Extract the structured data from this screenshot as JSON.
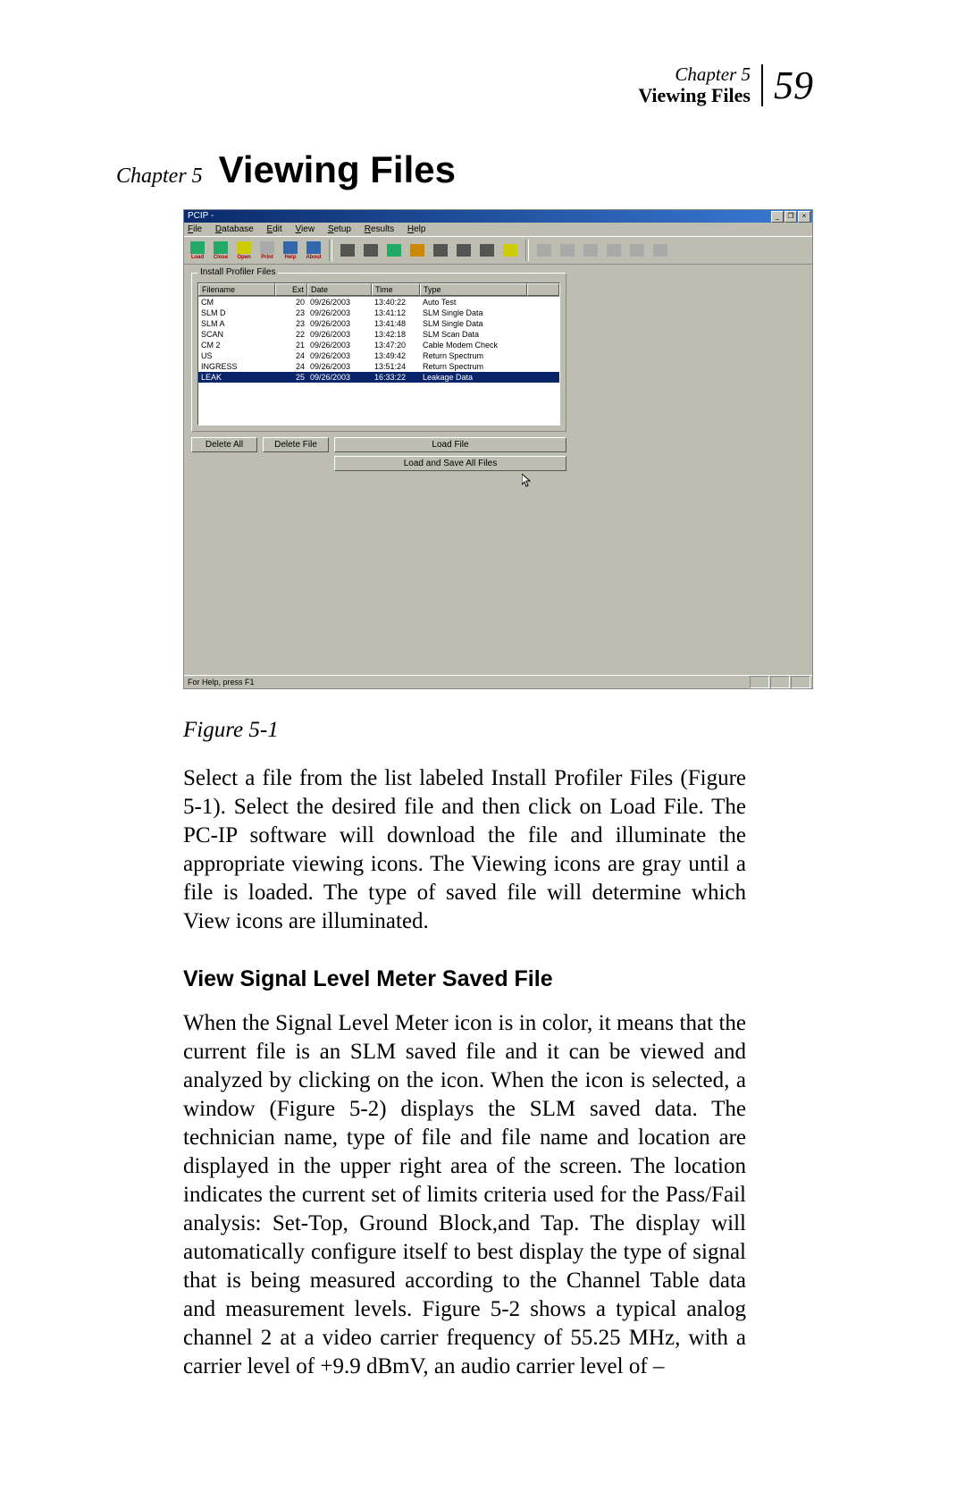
{
  "header": {
    "chapter_label": "Chapter 5",
    "title": "Viewing Files",
    "page_number": "59"
  },
  "chapter_heading": {
    "label": "Chapter 5",
    "title": "Viewing Files"
  },
  "screenshot": {
    "window_title": "PCIP -",
    "window_buttons": {
      "min": "_",
      "max": "❐",
      "close": "×"
    },
    "menu": [
      "File",
      "Database",
      "Edit",
      "View",
      "Setup",
      "Results",
      "Help"
    ],
    "toolbar_labels": [
      "Load",
      "Close",
      "Open",
      "Print",
      "Help",
      "About"
    ],
    "groupbox_title": "Install Profiler Files",
    "columns": [
      "Filename",
      "Ext",
      "Date",
      "Time",
      "Type"
    ],
    "rows": [
      {
        "filename": "CM",
        "ext": "20",
        "date": "09/26/2003",
        "time": "13:40:22",
        "type": "Auto Test"
      },
      {
        "filename": "SLM D",
        "ext": "23",
        "date": "09/26/2003",
        "time": "13:41:12",
        "type": "SLM Single Data"
      },
      {
        "filename": "SLM A",
        "ext": "23",
        "date": "09/26/2003",
        "time": "13:41:48",
        "type": "SLM Single Data"
      },
      {
        "filename": "SCAN",
        "ext": "22",
        "date": "09/26/2003",
        "time": "13:42:18",
        "type": "SLM Scan Data"
      },
      {
        "filename": "CM 2",
        "ext": "21",
        "date": "09/26/2003",
        "time": "13:47:20",
        "type": "Cable Modem Check"
      },
      {
        "filename": "US",
        "ext": "24",
        "date": "09/26/2003",
        "time": "13:49:42",
        "type": "Return Spectrum"
      },
      {
        "filename": "INGRESS",
        "ext": "24",
        "date": "09/26/2003",
        "time": "13:51:24",
        "type": "Return Spectrum"
      },
      {
        "filename": "LEAK",
        "ext": "25",
        "date": "09/26/2003",
        "time": "16:33:22",
        "type": "Leakage Data"
      }
    ],
    "buttons": {
      "delete_all": "Delete All",
      "delete_file": "Delete File",
      "load_file": "Load File",
      "load_save_all": "Load and Save All Files"
    },
    "statusbar": "For Help, press F1"
  },
  "figure_caption": "Figure 5-1",
  "paragraph1": "Select a file from the list labeled Install Profiler Files (Figure 5-1). Select the desired file and then click on Load File. The PC-IP software will download the file and illuminate the appropriate viewing icons. The Viewing icons are gray until a file is loaded. The type of saved file will determine which View icons are illuminated.",
  "section_heading": "View Signal Level Meter Saved File",
  "paragraph2": "When the Signal Level Meter icon is in color, it means that the current file is an SLM saved file and it can be viewed and analyzed by clicking on the icon. When the icon is selected, a window (Figure 5-2) displays the SLM saved data. The technician name, type of file and file name and location are displayed in the upper right area of the screen. The location indicates the current set of limits criteria used for the Pass/Fail analysis: Set-Top, Ground Block,and Tap. The display will automatically configure itself to best display the type of signal that is being measured according to the Channel Table data and measurement levels. Figure 5-2 shows a typical analog channel 2 at a video carrier frequency of 55.25 MHz, with a carrier level of +9.9 dBmV, an audio carrier level of –"
}
